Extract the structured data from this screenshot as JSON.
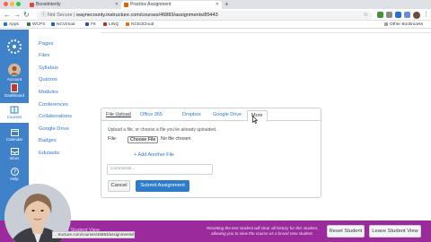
{
  "browser": {
    "tabs": [
      {
        "label": "Boostinterity",
        "active": false
      },
      {
        "label": "Practice Assignment",
        "active": true
      }
    ],
    "address": {
      "security": "Not Secure",
      "url": "waynecounty.instructure.com/courses/46883/assignments/85443"
    },
    "bookmarks": [
      {
        "label": "Apps"
      },
      {
        "label": "WCPS"
      },
      {
        "label": "NCVirtual"
      },
      {
        "label": "F8"
      },
      {
        "label": "LINQ"
      },
      {
        "label": "NCEdCloud"
      }
    ],
    "other_bookmarks": "Other Bookmarks"
  },
  "global_nav": {
    "items": [
      {
        "label": "Account"
      },
      {
        "label": "Dashboard"
      },
      {
        "label": "Courses"
      },
      {
        "label": "Calendar"
      },
      {
        "label": "Inbox"
      },
      {
        "label": "Help"
      }
    ]
  },
  "course_nav": {
    "items": [
      {
        "label": "Pages"
      },
      {
        "label": "Files"
      },
      {
        "label": "Syllabus"
      },
      {
        "label": "Quizzes"
      },
      {
        "label": "Modules"
      },
      {
        "label": "Conferences"
      },
      {
        "label": "Collaborations"
      },
      {
        "label": "Google Drive"
      },
      {
        "label": "Badges"
      },
      {
        "label": "Edulastic"
      }
    ]
  },
  "submission": {
    "tabs": [
      {
        "label": "File Upload",
        "state": "active"
      },
      {
        "label": "Office 365",
        "state": "link"
      },
      {
        "label": "Dropbox",
        "state": "link"
      },
      {
        "label": "Google Drive",
        "state": "link"
      },
      {
        "label": "More",
        "state": "hover"
      }
    ],
    "hint": "Upload a file, or choose a file you've already uploaded.",
    "file_label": "File:",
    "choose_button": "Choose File",
    "no_file": "No file chosen",
    "add_file": "+ Add Another File",
    "comments_placeholder": "Comments...",
    "cancel_button": "Cancel",
    "submit_button": "Submit Assignment"
  },
  "student_view": {
    "leave_link": "Leave Student View",
    "message": "Resetting the test student will clear all history for this student, allowing you to view the course as a brand new student.",
    "reset_button": "Reset Student",
    "leave_button": "Leave Student View"
  },
  "status_url": "...tructure.com/courses/46883/assignments/85443/submissions",
  "colors": {
    "global_nav": "#3f82c9",
    "link": "#2d7bc9",
    "submit": "#2d7bc9",
    "student_view_bar": "#9b2a9d",
    "active_nav_marker": "#c0392b"
  }
}
